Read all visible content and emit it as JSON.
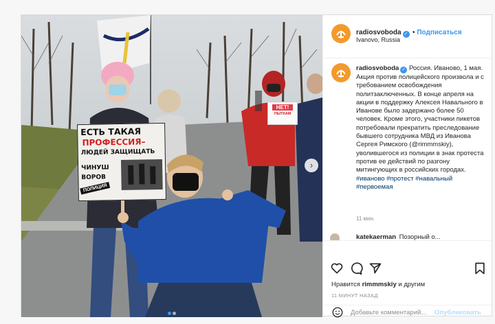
{
  "post": {
    "username": "radiosvoboda",
    "follow_label": "Подписаться",
    "location": "Ivanovo, Russia",
    "caption": "Россия. Иваново, 1 мая. Акция против полицейского произвола и с требованием освобождения политзаключенных. В конце апреля на акции в поддержку Алексея Навального в Иванове было задержано более 50 человек. Кроме этого, участники пикетов потребовали прекратить преследование бывшего сотрудника МВД из Иванова Сергея Римского (@rimmmskiy), уволившегося из полиции в знак протеста против ее действий по разгону митингующих в российских городах.",
    "hashtags": "#иваново #протест #навальный #первоемая",
    "caption_time": "11 мин.",
    "next_comment_user": "katekaerman",
    "next_comment_text": "Позорный о...",
    "likes_prefix": "Нравится",
    "likes_user": "rimmmskiy",
    "likes_suffix": "и другим",
    "timestamp": "11 МИНУТ НАЗАД",
    "comment_placeholder": "Добавьте комментарий...",
    "publish_label": "Опубликовать"
  },
  "photo": {
    "sign_main": "ЕСТЬ ТАКАЯ ПРОФЕССИЯ – ЛЮДЕЙ ЗАЩИЩАТЬ",
    "sign_main_line1": "ЕСТЬ ТАКАЯ",
    "sign_main_line2": "ПРОФЕССИЯ–",
    "sign_main_line3": "ЛЮДЕЙ ЗАЩИЩАТЬ",
    "sign_main_line4": "ЧИНУШ ВОРОВ",
    "sign_tag": "ПОЛИЦИЯ",
    "sign_small_line1": "НЕТ!",
    "sign_small_line2": "ПЫТКАМ"
  },
  "colors": {
    "accent_blue": "#3897f0",
    "brand_orange": "#f39a2d"
  }
}
